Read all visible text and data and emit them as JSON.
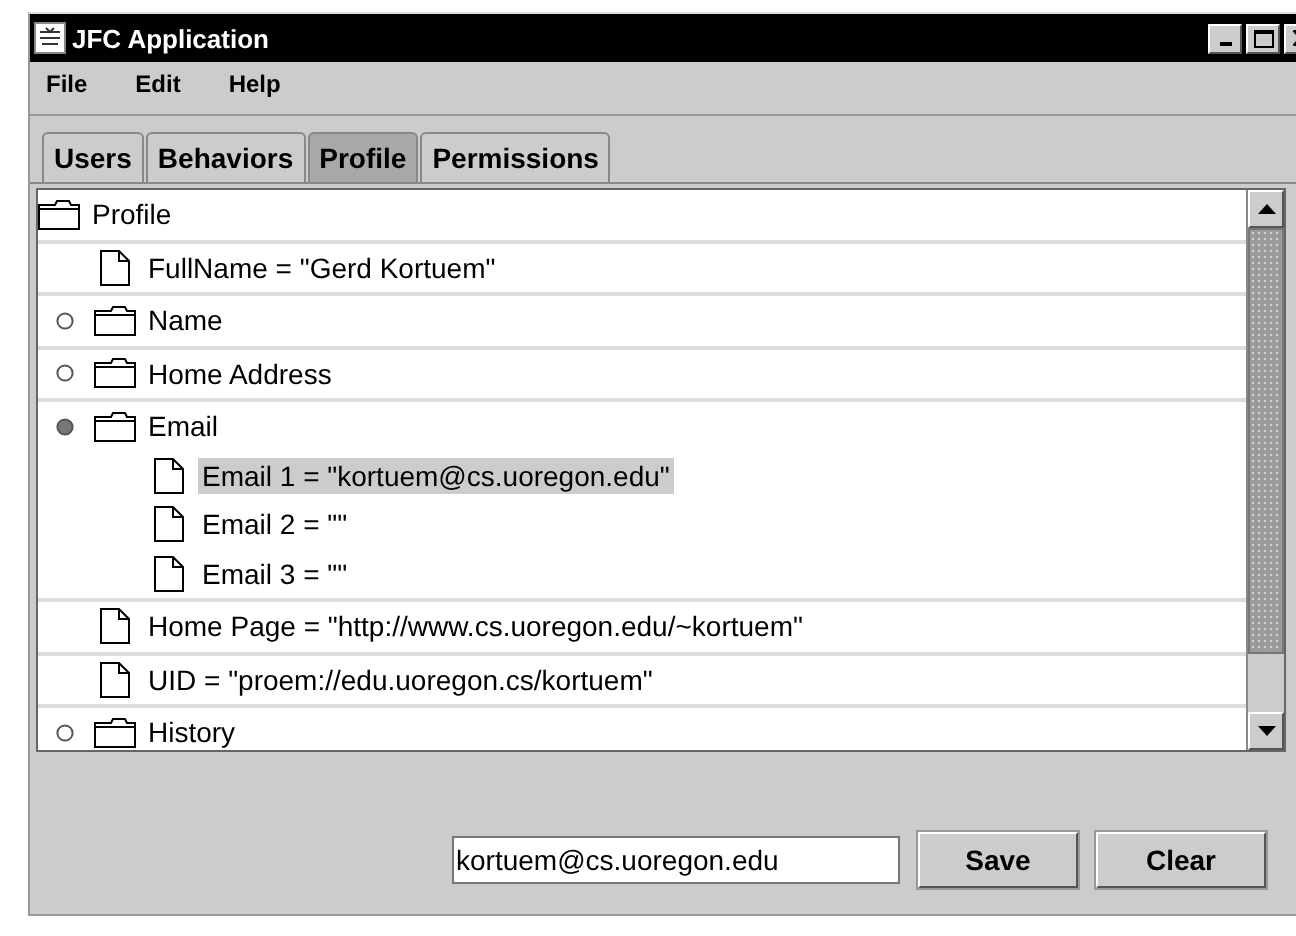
{
  "window": {
    "title": "JFC Application"
  },
  "menu": [
    "File",
    "Edit",
    "Help"
  ],
  "tabs": [
    {
      "label": "Users",
      "selected": false
    },
    {
      "label": "Behaviors",
      "selected": false
    },
    {
      "label": "Profile",
      "selected": true
    },
    {
      "label": "Permissions",
      "selected": false
    }
  ],
  "tree": {
    "label": "Profile",
    "kind": "folder",
    "children": [
      {
        "label": "FullName = \"Gerd Kortuem\"",
        "kind": "leaf",
        "selected": false
      },
      {
        "label": "Name",
        "kind": "folder",
        "expanded": false,
        "selected": false
      },
      {
        "label": "Home Address",
        "kind": "folder",
        "expanded": false,
        "selected": false
      },
      {
        "label": "Email",
        "kind": "folder",
        "expanded": true,
        "selected": false,
        "children": [
          {
            "label": "Email 1 = \"kortuem@cs.uoregon.edu\"",
            "kind": "leaf",
            "selected": true
          },
          {
            "label": "Email 2 = \"\"",
            "kind": "leaf",
            "selected": false
          },
          {
            "label": "Email 3 = \"\"",
            "kind": "leaf",
            "selected": false
          }
        ]
      },
      {
        "label": "Home Page = \"http://www.cs.uoregon.edu/~kortuem\"",
        "kind": "leaf",
        "selected": false
      },
      {
        "label": "UID = \"proem://edu.uoregon.cs/kortuem\"",
        "kind": "leaf",
        "selected": false
      },
      {
        "label": "History",
        "kind": "folder",
        "expanded": false,
        "selected": false
      }
    ]
  },
  "editor": {
    "value": "kortuem@cs.uoregon.edu"
  },
  "buttons": [
    "Save",
    "Clear"
  ]
}
